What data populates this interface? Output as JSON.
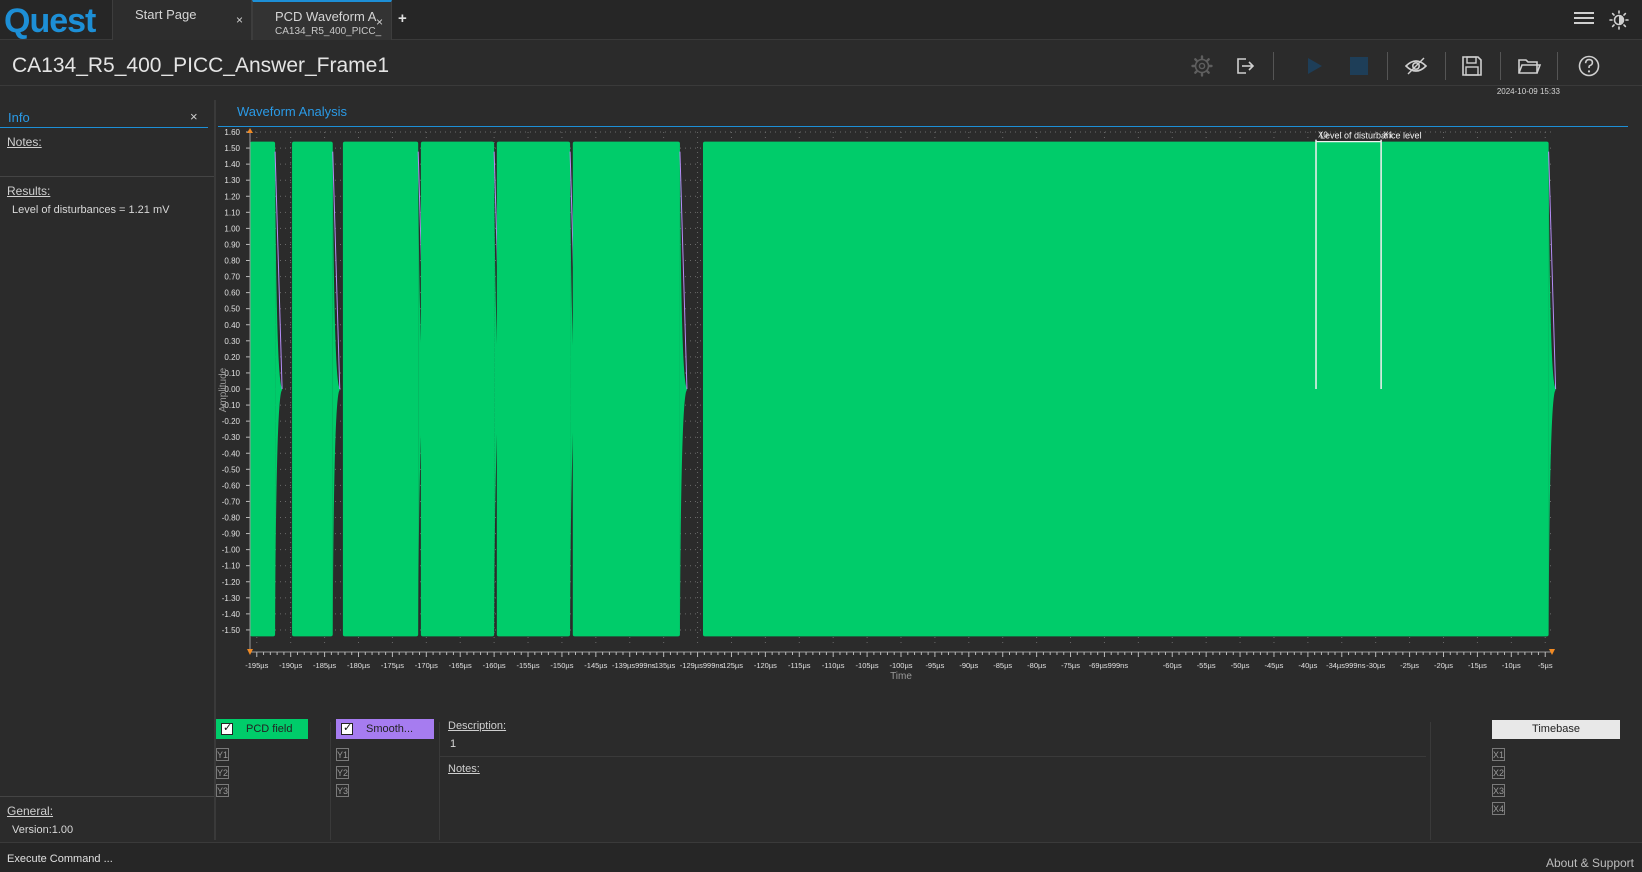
{
  "app": {
    "logo_text": "Quest"
  },
  "tabs": [
    {
      "label": "Start Page",
      "sublabel": ""
    },
    {
      "label": "PCD Waveform A",
      "sublabel": "CA134_R5_400_PICC_"
    }
  ],
  "tab_close": "×",
  "tab_add": "+",
  "page": {
    "title": "CA134_R5_400_PICC_Answer_Frame1",
    "timestamp": "2024-10-09 15:33"
  },
  "toolbar_icons": [
    "gear-icon",
    "export-icon",
    "play-icon",
    "stop-icon",
    "eye-icon",
    "save-icon",
    "folder-open-icon",
    "help-icon"
  ],
  "info": {
    "title": "Info",
    "close": "×",
    "notes_label": "Notes:",
    "results_label": "Results:",
    "result_line": "Level of disturbances = 1.21 mV",
    "general_label": "General:",
    "version": "Version:1.00"
  },
  "waveform": {
    "title": "Waveform Analysis"
  },
  "chart_data": {
    "type": "line",
    "ylabel": "Amplitude",
    "xlabel": "Time",
    "ylim": [
      -1.6,
      1.6
    ],
    "y_ticks": [
      "1.60",
      "1.50",
      "1.40",
      "1.30",
      "1.20",
      "1.10",
      "1.00",
      "0.90",
      "0.80",
      "0.70",
      "0.60",
      "0.50",
      "0.40",
      "0.30",
      "0.20",
      "0.10",
      "0.00",
      "-0.10",
      "-0.20",
      "-0.30",
      "-0.40",
      "-0.50",
      "-0.60",
      "-0.70",
      "-0.80",
      "-0.90",
      "-1.00",
      "-1.10",
      "-1.20",
      "-1.30",
      "-1.40",
      "-1.50"
    ],
    "x_ticks": [
      "-195µs",
      "-190µs",
      "-185µs",
      "-180µs",
      "-175µs",
      "-170µs",
      "-165µs",
      "-160µs",
      "-155µs",
      "-150µs",
      "-145µs",
      "-139µs999ns",
      "-135µs",
      "-129µs999ns",
      "-125µs",
      "-120µs",
      "-115µs",
      "-110µs",
      "-105µs",
      "-100µs",
      "-95µs",
      "-90µs",
      "-85µs",
      "-80µs",
      "-75µs",
      "-69µs999ns",
      "-60µs",
      "-55µs",
      "-50µs",
      "-45µs",
      "-40µs",
      "-34µs999ns",
      "-30µs",
      "-25µs",
      "-20µs",
      "-15µs",
      "-10µs",
      "-5µs"
    ],
    "xlim": [
      -196,
      -4
    ],
    "series": [
      {
        "name": "PCD field",
        "color": "#00cc6a",
        "envelope_segments": [
          [
            -196,
            -192.3
          ],
          [
            -189.8,
            -183.8
          ],
          [
            -182.3,
            -171.2
          ],
          [
            -170.8,
            -160.0
          ],
          [
            -159.6,
            -148.8
          ],
          [
            -148.4,
            -132.6
          ],
          [
            -129.2,
            -4.5
          ]
        ],
        "amplitude": 1.54
      }
    ],
    "cursors": [
      {
        "label": "X0",
        "x": -38.8
      },
      {
        "label": "X1",
        "x": -29.2
      }
    ],
    "annotation": "Level of disturbance level"
  },
  "channels": {
    "pcd": {
      "label": "PCD field",
      "color": "#00cc6a"
    },
    "smooth": {
      "label": "Smooth...",
      "color": "#a67cf0"
    },
    "y_boxes": [
      "Y1",
      "Y2",
      "Y3"
    ]
  },
  "description": {
    "label": "Description:",
    "value": "1",
    "notes_label": "Notes:"
  },
  "timebase": {
    "label": "Timebase",
    "x_boxes": [
      "X1",
      "X2",
      "X3",
      "X4"
    ]
  },
  "status": {
    "exec": "Execute Command ...",
    "about": "About & Support"
  }
}
